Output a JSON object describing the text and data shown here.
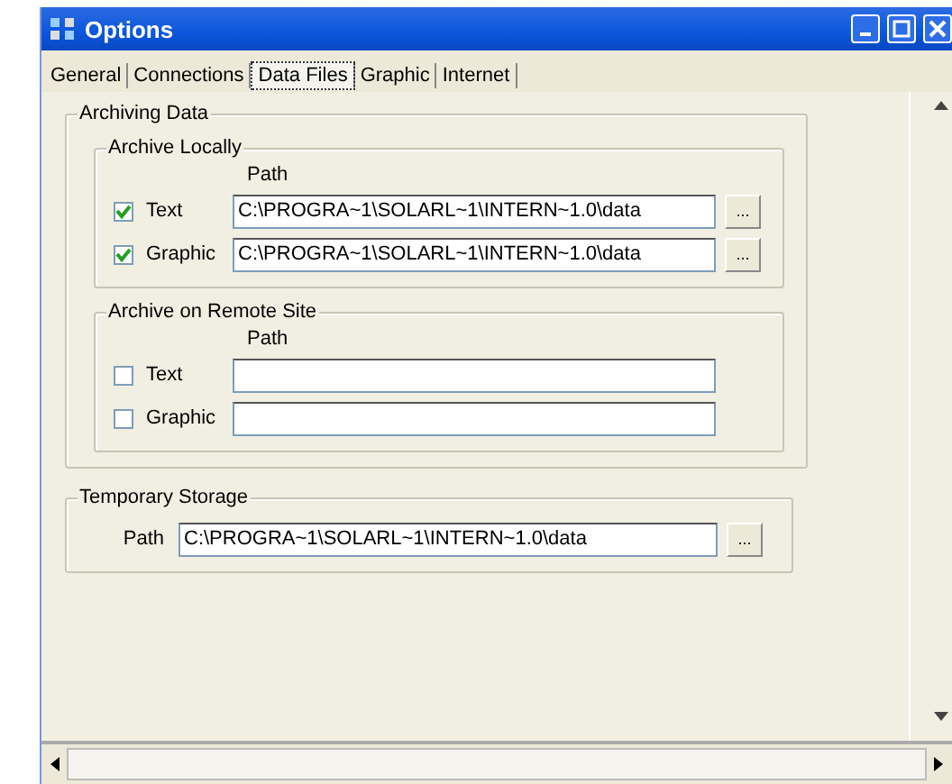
{
  "window": {
    "title": "Options"
  },
  "tabs": [
    {
      "label": "General",
      "selected": false
    },
    {
      "label": "Connections",
      "selected": false
    },
    {
      "label": "Data Files",
      "selected": true
    },
    {
      "label": "Graphic",
      "selected": false
    },
    {
      "label": "Internet",
      "selected": false
    }
  ],
  "archiving_data": {
    "title": "Archiving Data",
    "groups": [
      {
        "title": "Archive Locally",
        "path_header": "Path",
        "rows": [
          {
            "label": "Text",
            "checked": true,
            "value": "C:\\PROGRA~1\\SOLARL~1\\INTERN~1.0\\data",
            "browse": "..."
          },
          {
            "label": "Graphic",
            "checked": true,
            "value": "C:\\PROGRA~1\\SOLARL~1\\INTERN~1.0\\data",
            "browse": "..."
          }
        ]
      },
      {
        "title": "Archive on Remote Site",
        "path_header": "Path",
        "rows": [
          {
            "label": "Text",
            "checked": false
          },
          {
            "label": "Graphic",
            "checked": false
          }
        ]
      }
    ]
  },
  "temporary_storage": {
    "title": "Temporary Storage",
    "label": "Path",
    "value": "C:\\PROGRA~1\\SOLARL~1\\INTERN~1.0\\data",
    "browse": "..."
  }
}
